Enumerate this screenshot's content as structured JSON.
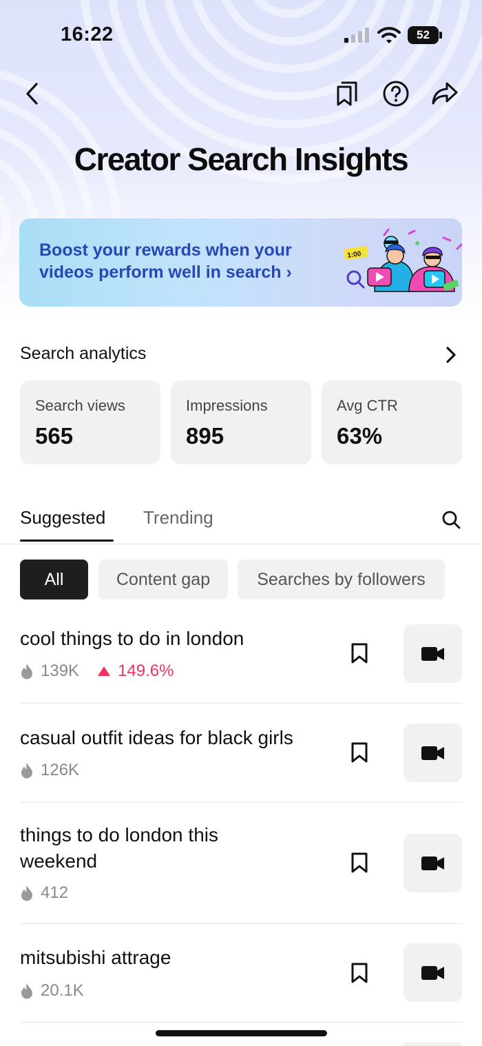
{
  "status_bar": {
    "time": "16:22",
    "battery": "52"
  },
  "header": {
    "title": "Creator Search Insights"
  },
  "banner": {
    "line1": "Boost your rewards when your",
    "line2": "videos perform well in search",
    "chevron": "›",
    "timer_label": "1:00"
  },
  "analytics": {
    "heading": "Search analytics",
    "stats": [
      {
        "label": "Search views",
        "value": "565"
      },
      {
        "label": "Impressions",
        "value": "895"
      },
      {
        "label": "Avg CTR",
        "value": "63%"
      }
    ]
  },
  "tabs": [
    {
      "label": "Suggested",
      "active": true
    },
    {
      "label": "Trending",
      "active": false
    }
  ],
  "filters": [
    {
      "label": "All",
      "selected": true
    },
    {
      "label": "Content gap",
      "selected": false
    },
    {
      "label": "Searches by followers",
      "selected": false
    }
  ],
  "results": [
    {
      "title": "cool things to do in london",
      "count": "139K",
      "trend": "149.6%"
    },
    {
      "title": "casual outfit ideas for black girls",
      "count": "126K"
    },
    {
      "title_line1": "things to do london this",
      "title_line2": "weekend",
      "count": "412"
    },
    {
      "title": "mitsubishi attrage",
      "count": "20.1K"
    }
  ],
  "icons": {
    "back": "chevron-left-icon",
    "bookmarks": "bookmarks-icon",
    "help": "help-circle-icon",
    "share": "share-arrow-icon",
    "search": "search-icon",
    "flame": "flame-icon",
    "bookmark": "bookmark-icon",
    "video": "video-camera-icon"
  },
  "colors": {
    "banner_text": "#2647b4",
    "trend_up": "#f0335d",
    "chip_selected": "#1e1e1e",
    "card_bg": "#f1f1f2"
  }
}
